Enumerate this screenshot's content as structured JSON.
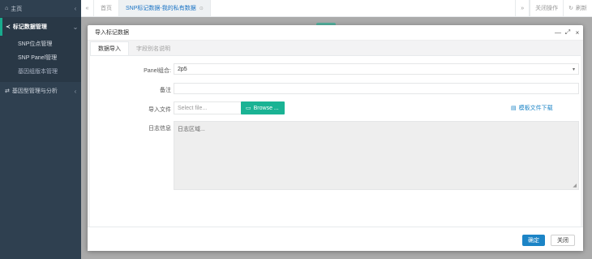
{
  "sidebar": {
    "home": {
      "icon": "home-icon",
      "label": "主页",
      "arrow": "‹"
    },
    "group1": {
      "icon": "share-icon",
      "label": "标记数据管理",
      "arrow": "⌄"
    },
    "items": [
      {
        "label": "SNP位点管理"
      },
      {
        "label": "SNP Panel管理"
      },
      {
        "label": "基因组版本管理"
      }
    ],
    "group2": {
      "icon": "shuffle-icon",
      "label": "基因型管理与分析",
      "arrow": "‹"
    }
  },
  "topbar": {
    "back_icon": "«",
    "tabs": [
      {
        "label": "首页"
      },
      {
        "label": "SNP标记数据-我的私有数据",
        "close": "⊙"
      }
    ],
    "forward_icon": "»",
    "close_ops": "关闭操作",
    "refresh_icon": "↻",
    "refresh": "刷新"
  },
  "modal": {
    "title": "导入标记数据",
    "controls": {
      "minimize": "—",
      "maximize": "⤢",
      "close": "×"
    },
    "tabs": [
      {
        "label": "数据导入"
      },
      {
        "label": "字段别名说明"
      }
    ],
    "form": {
      "panel_label": "Panel组合:",
      "panel_value": "2p5",
      "panel_caret": "▾",
      "note_label": "备注",
      "note_value": "",
      "file_label": "导入文件",
      "file_placeholder": "Select file...",
      "browse_icon": "folder-open-icon",
      "browse_label": "Browse ...",
      "download_icon": "file-icon",
      "download_label": "模板文件下载",
      "log_label": "日志信息",
      "log_placeholder": "日志区域..."
    },
    "footer": {
      "ok": "确定",
      "close": "关闭"
    }
  },
  "colors": {
    "sidebar_bg": "#2f4050",
    "accent_green": "#1ab394",
    "primary_blue": "#1c84c6"
  }
}
